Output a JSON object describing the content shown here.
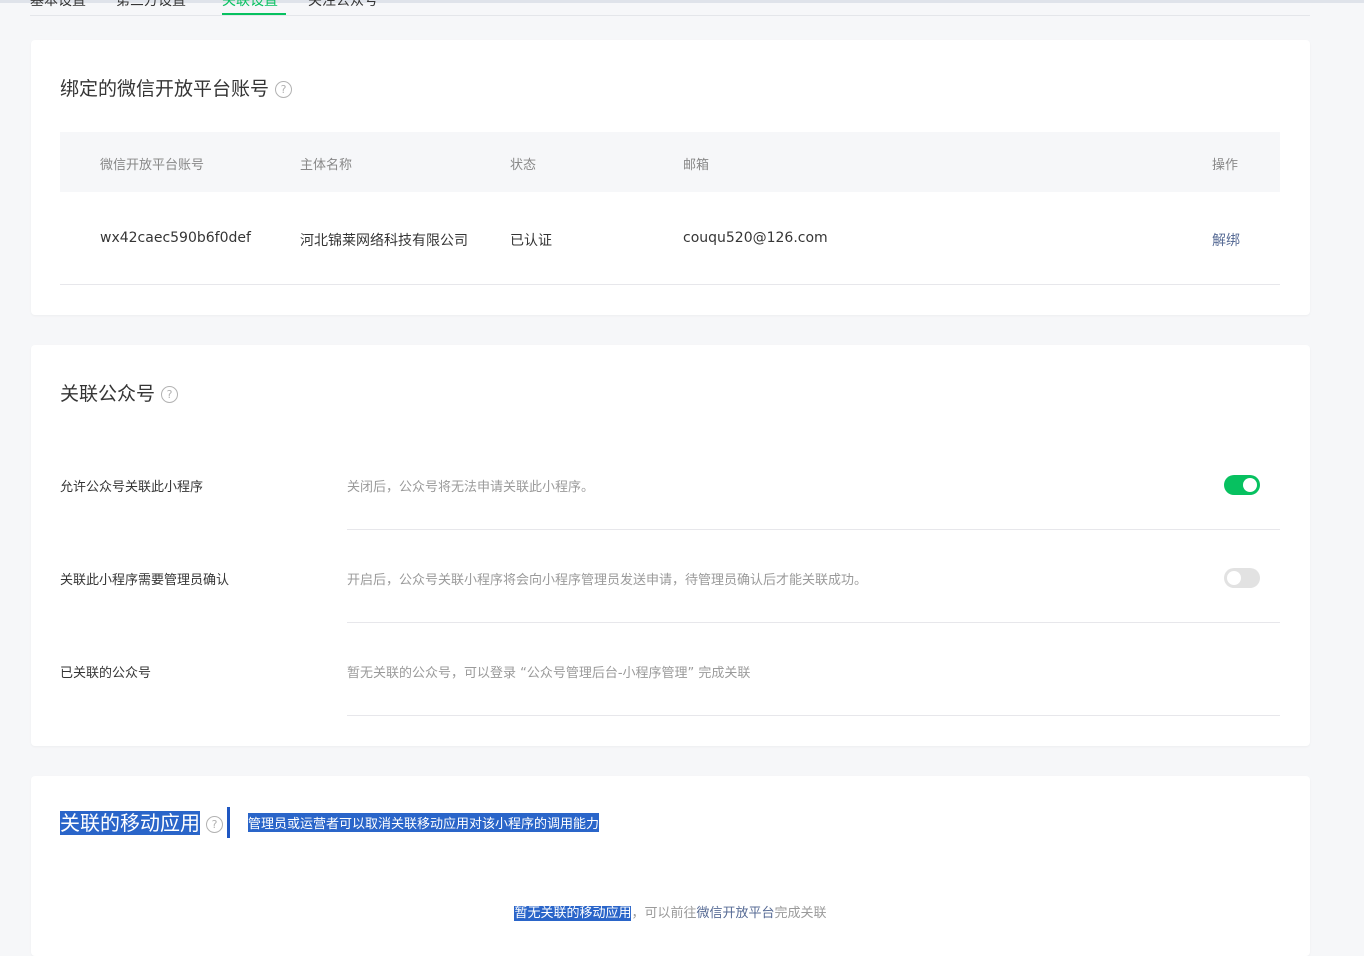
{
  "tabs": [
    {
      "label": "基本设置",
      "active": false
    },
    {
      "label": "第三方设置",
      "active": false
    },
    {
      "label": "关联设置",
      "active": true
    },
    {
      "label": "关注公众号",
      "active": false
    }
  ],
  "open_platform": {
    "title": "绑定的微信开放平台账号",
    "columns": [
      "微信开放平台账号",
      "主体名称",
      "状态",
      "邮箱",
      "操作"
    ],
    "rows": [
      {
        "account": "wx42caec590b6f0def",
        "entity": "河北锦莱网络科技有限公司",
        "status": "已认证",
        "email": "couqu520@126.com",
        "action": "解绑"
      }
    ]
  },
  "official_account": {
    "title": "关联公众号",
    "settings": [
      {
        "label": "允许公众号关联此小程序",
        "desc": "关闭后，公众号将无法申请关联此小程序。",
        "toggle": true
      },
      {
        "label": "关联此小程序需要管理员确认",
        "desc": "开启后，公众号关联小程序将会向小程序管理员发送申请，待管理员确认后才能关联成功。",
        "toggle": false
      },
      {
        "label": "已关联的公众号",
        "desc": "暂无关联的公众号，可以登录 “公众号管理后台-小程序管理” 完成关联"
      }
    ]
  },
  "mobile_app": {
    "title": "关联的移动应用",
    "subtitle": "管理员或运营者可以取消关联移动应用对该小程序的调用能力",
    "empty_prefix": "暂无关联的移动应用",
    "empty_middle": "，可以前往",
    "empty_link": "微信开放平台",
    "empty_suffix": "完成关联"
  },
  "colors": {
    "accent": "#07c160",
    "link": "#576b95",
    "selection": "#2a65c9"
  }
}
